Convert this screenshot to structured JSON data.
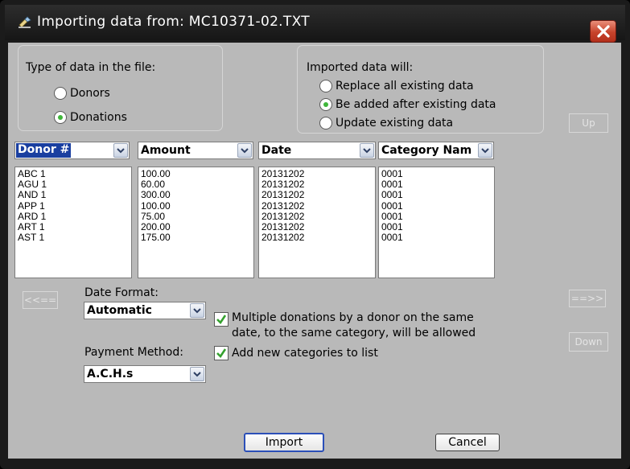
{
  "window": {
    "title": "Importing data from: MC10371-02.TXT",
    "close_icon": "close-icon",
    "accent": "#c7432b"
  },
  "data_type": {
    "title": "Type of data in the file:",
    "options": [
      {
        "label": "Donors",
        "checked": false
      },
      {
        "label": "Donations",
        "checked": true
      }
    ]
  },
  "import_mode": {
    "title": "Imported data will:",
    "options": [
      {
        "label": "Replace all existing data",
        "checked": false
      },
      {
        "label": "Be added after existing data",
        "checked": true
      },
      {
        "label": "Update existing data",
        "checked": false
      }
    ]
  },
  "columns": [
    {
      "header": "Donor #",
      "rows": [
        "ABC 1",
        "AGU 1",
        "AND 1",
        "APP 1",
        "ARD 1",
        "ART 1",
        "AST 1"
      ]
    },
    {
      "header": "Amount",
      "rows": [
        "100.00",
        "60.00",
        "300.00",
        "100.00",
        "75.00",
        "200.00",
        "175.00"
      ]
    },
    {
      "header": "Date",
      "rows": [
        "20131202",
        "20131202",
        "20131202",
        "20131202",
        "20131202",
        "20131202",
        "20131202"
      ]
    },
    {
      "header": "Category Nam",
      "rows": [
        "0001",
        "0001",
        "0001",
        "0001",
        "0001",
        "0001",
        "0001"
      ]
    }
  ],
  "buttons": {
    "up": "Up",
    "down": "Down",
    "left": "<<==",
    "right": "==>>",
    "import": "Import",
    "cancel": "Cancel"
  },
  "date_format": {
    "label": "Date Format:",
    "value": "Automatic"
  },
  "payment_method": {
    "label": "Payment Method:",
    "value": "A.C.H.s"
  },
  "options": {
    "multiple_donations": {
      "line1": "Multiple donations by a donor on the same",
      "line2": "date, to the same category, will be allowed",
      "checked": true
    },
    "add_categories": {
      "label": "Add new categories to list",
      "checked": true
    }
  }
}
